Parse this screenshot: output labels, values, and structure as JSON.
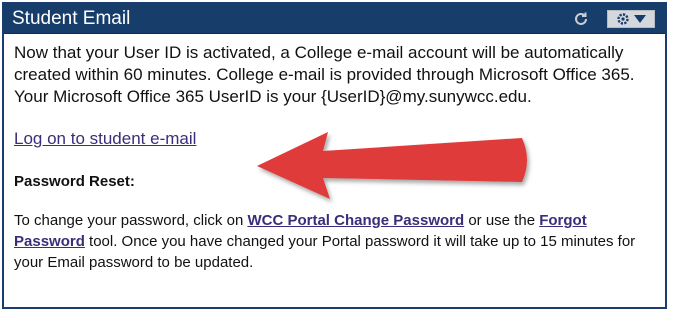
{
  "portlet": {
    "title": "Student Email",
    "icons": {
      "refresh": "refresh-icon",
      "settings": "gear-icon",
      "menu": "chevron-down-icon"
    }
  },
  "content": {
    "intro": "Now that your User ID is activated, a College e-mail account will be automatically created within 60 minutes. College e-mail is provided through Microsoft Office 365. Your Microsoft Office 365 UserID is your {UserID}@my.sunywcc.edu.",
    "logon_link": "Log on to student e-mail",
    "reset_heading": "Password Reset:",
    "reset_text_1": "To change your password, click on ",
    "reset_link_1": "WCC Portal Change Password",
    "reset_text_2": " or use the ",
    "reset_link_2": "Forgot Password",
    "reset_text_3": " tool.  Once you have changed your Portal password it will take up to 15 minutes for your Email password to be updated."
  },
  "annotation": {
    "arrow_color": "#e03b3b",
    "header_color": "#173d6b",
    "link_color": "#3c2d7a"
  }
}
